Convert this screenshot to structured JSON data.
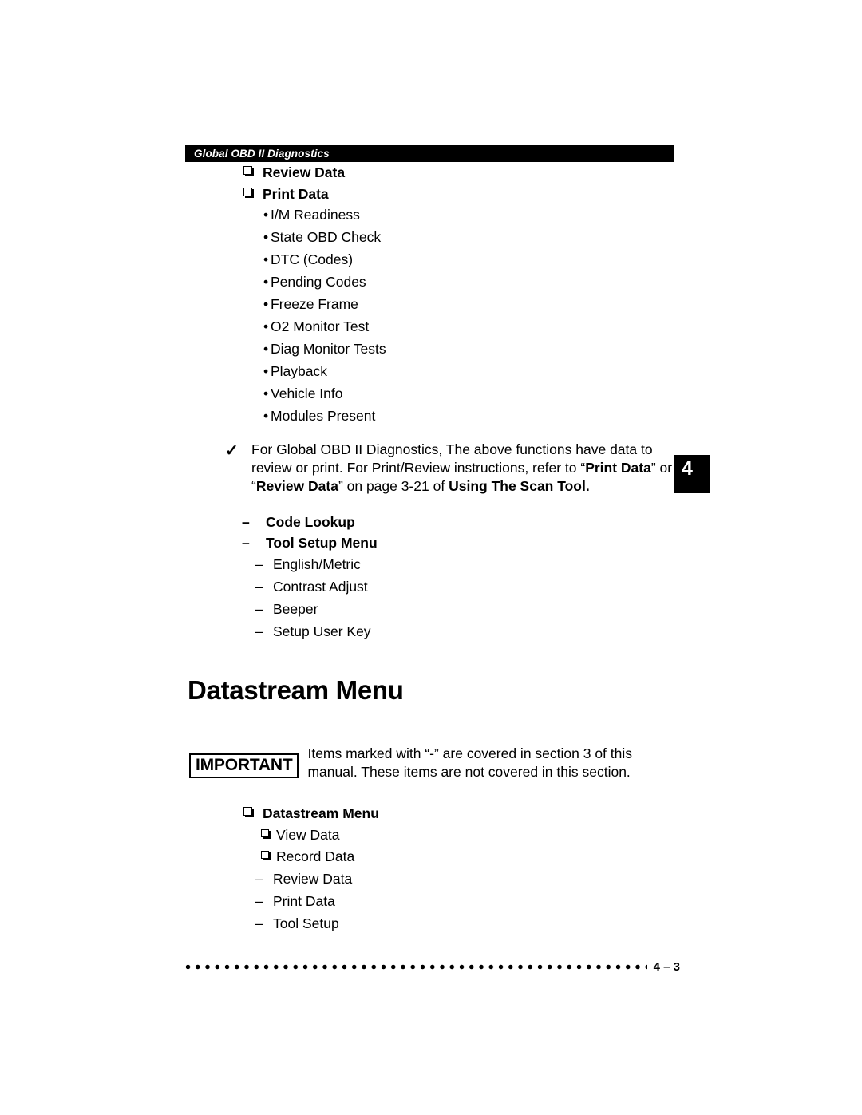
{
  "header": {
    "title": "Global OBD II Diagnostics"
  },
  "chapter_tab": {
    "number": "4"
  },
  "obd_section": {
    "checkbox_items": [
      {
        "label": "Review Data"
      },
      {
        "label": "Print Data"
      }
    ],
    "bullet_items": [
      {
        "marker": "•",
        "label": "I/M Readiness"
      },
      {
        "marker": "•",
        "label": "State OBD Check"
      },
      {
        "marker": "•",
        "label": "DTC (Codes)"
      },
      {
        "marker": "•",
        "label": "Pending Codes"
      },
      {
        "marker": "•",
        "label": "Freeze Frame"
      },
      {
        "marker": "•",
        "label": "O2 Monitor Test"
      },
      {
        "marker": "•",
        "label": "Diag Monitor Tests"
      },
      {
        "marker": "•",
        "label": "Playback"
      },
      {
        "marker": "•",
        "label": "Vehicle Info"
      },
      {
        "marker": "•",
        "label": "Modules Present"
      }
    ],
    "check_note": {
      "tick": "✓",
      "text_part1": "For Global OBD II Diagnostics, The above functions have data to review or print. For Print/Review instructions, refer to “",
      "bold1": "Print Data",
      "text_part2": "” or “",
      "bold2": "Review Data",
      "text_part3": "” on page 3-21 of ",
      "bold3": "Using The Scan Tool.",
      "text_part4": ""
    },
    "dash_bold_items": [
      {
        "marker": "–",
        "label": "Code Lookup"
      },
      {
        "marker": "–",
        "label": "Tool Setup Menu"
      }
    ],
    "dash_items": [
      {
        "marker": "–",
        "label": "English/Metric"
      },
      {
        "marker": "–",
        "label": "Contrast Adjust"
      },
      {
        "marker": "–",
        "label": "Beeper"
      },
      {
        "marker": "–",
        "label": "Setup User Key"
      }
    ]
  },
  "datastream_section": {
    "heading": "Datastream Menu",
    "important": {
      "badge": "IMPORTANT",
      "text": "Items marked with “-” are covered in section 3 of this manual. These items are not covered in this section."
    },
    "root_item": {
      "label": "Datastream Menu"
    },
    "checkbox_subitems": [
      {
        "label": "View Data"
      },
      {
        "label": "Record Data"
      }
    ],
    "dash_subitems": [
      {
        "marker": "–",
        "label": "Review Data"
      },
      {
        "marker": "–",
        "label": "Print Data"
      },
      {
        "marker": "–",
        "label": "Tool Setup"
      }
    ]
  },
  "footer": {
    "page_number": "4 – 3"
  }
}
